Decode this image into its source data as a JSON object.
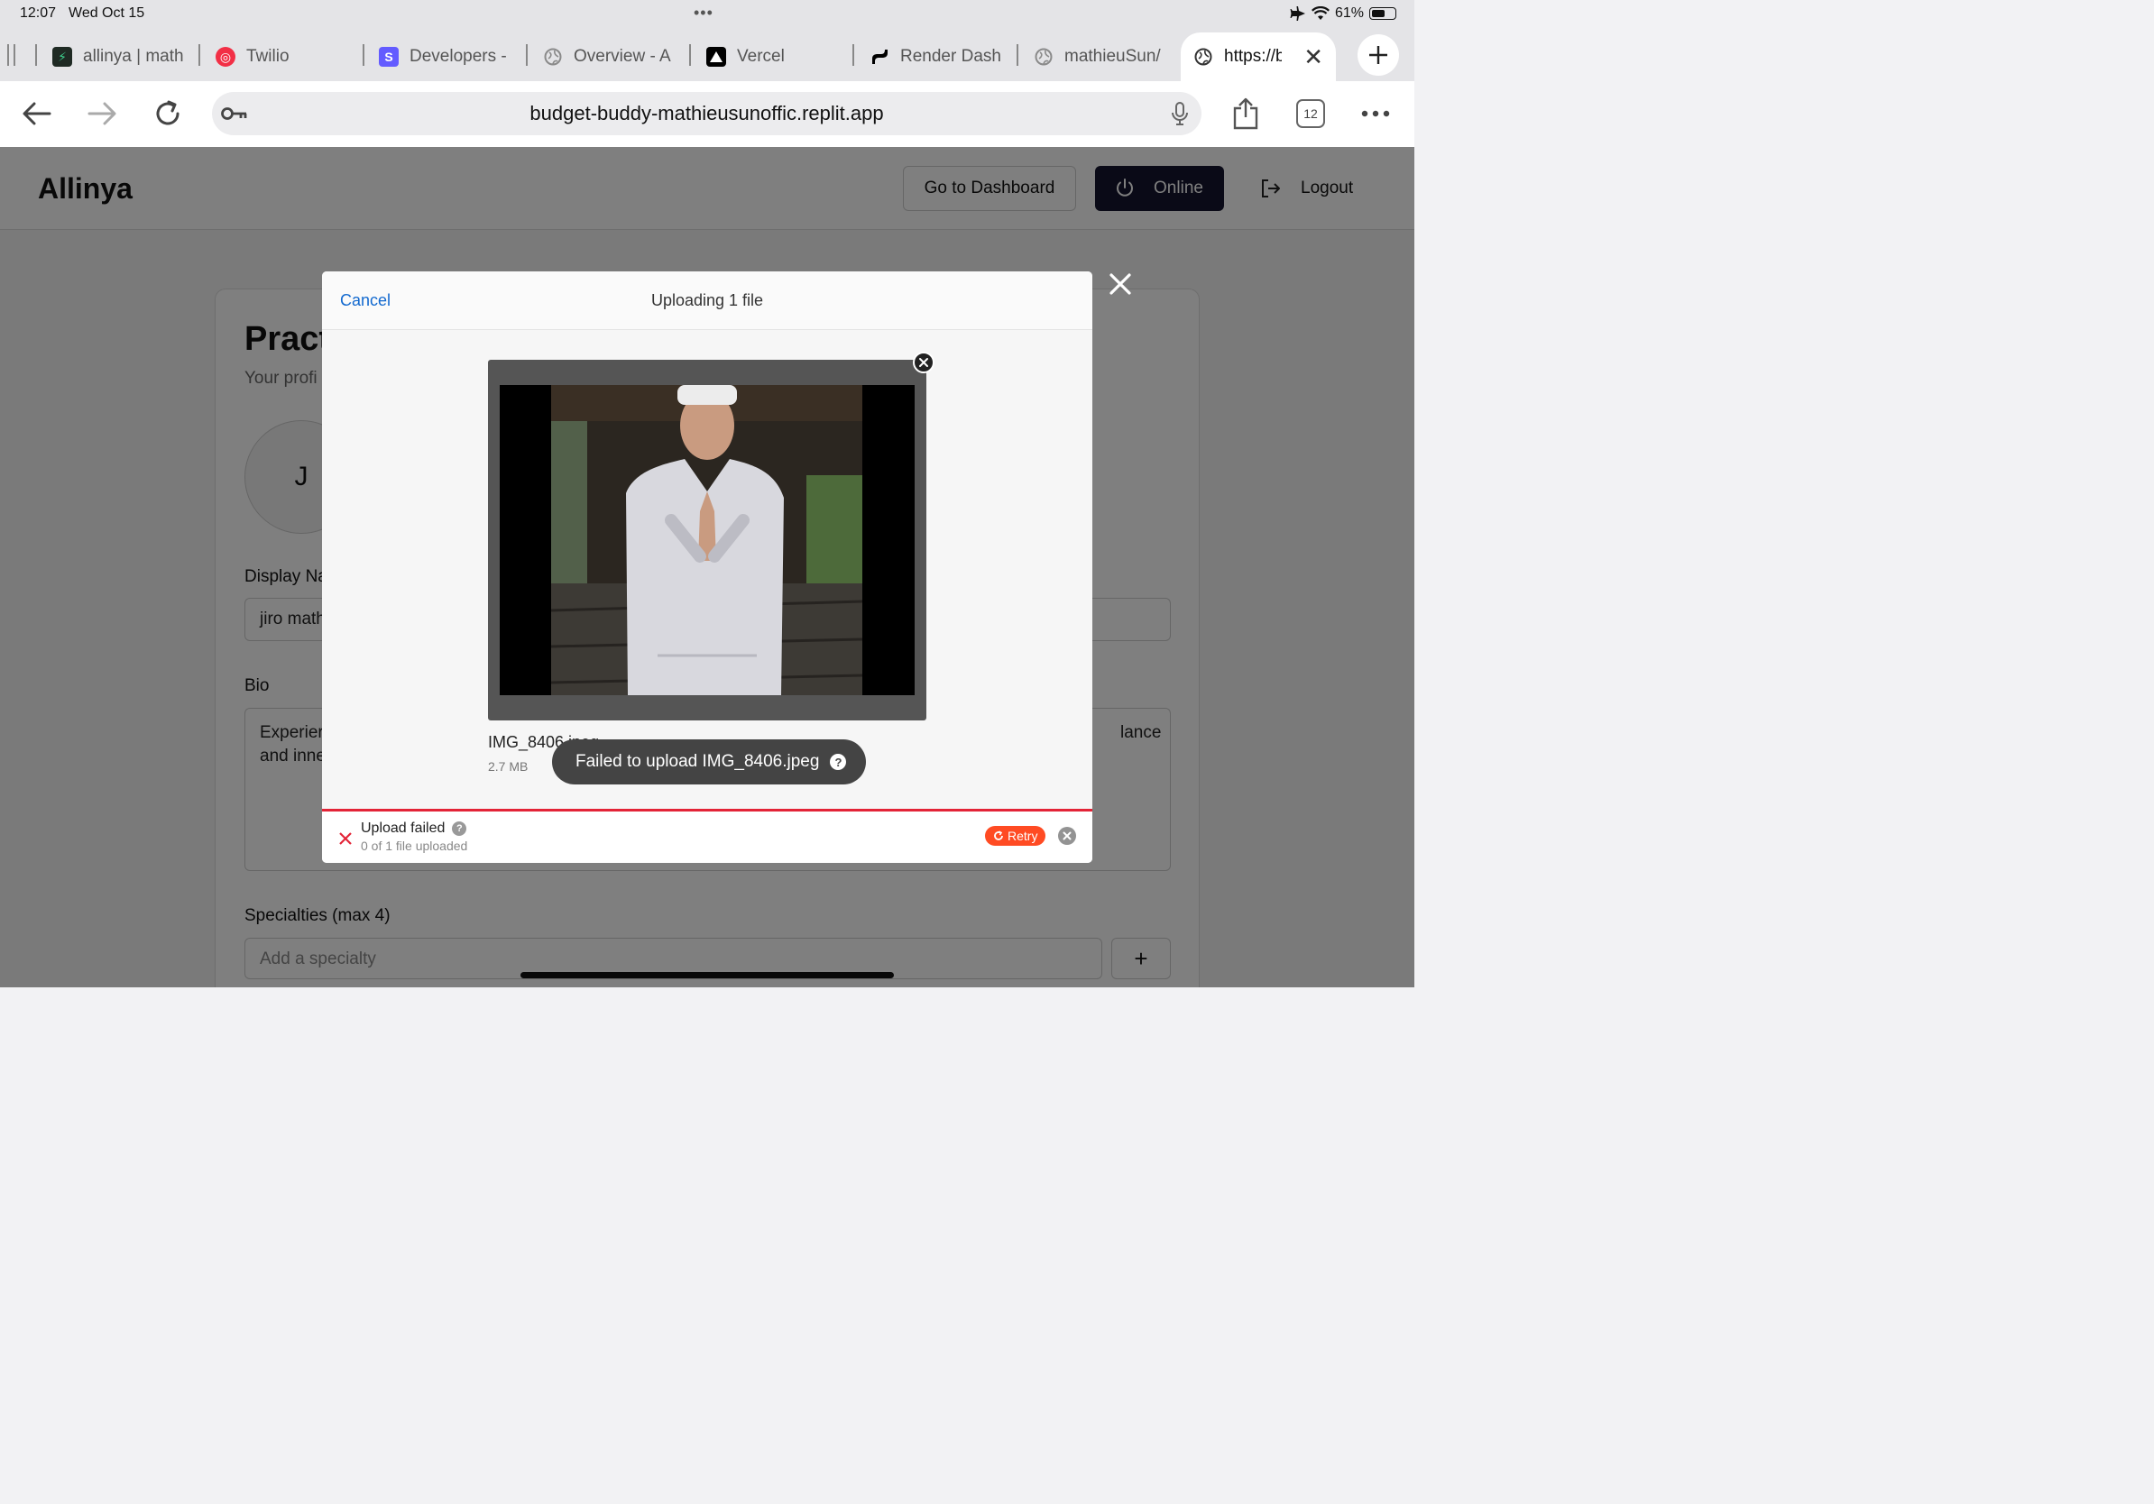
{
  "status_bar": {
    "time": "12:07",
    "date": "Wed Oct 15",
    "battery": "61%",
    "battery_level": 0.61
  },
  "browser": {
    "tabs": [
      {
        "title": "allinya | math",
        "favicon": "bolt-icon",
        "color": "#1f2a24"
      },
      {
        "title": "Twilio",
        "favicon": "twilio-icon",
        "color": "#f22f46"
      },
      {
        "title": "Developers -",
        "favicon": "stripe-icon",
        "color": "#635bff"
      },
      {
        "title": "Overview - A",
        "favicon": "globe-icon",
        "color": "#8a8a8a"
      },
      {
        "title": "Vercel",
        "favicon": "vercel-icon",
        "color": "#000000"
      },
      {
        "title": "Render Dash",
        "favicon": "render-icon",
        "color": "#000000"
      },
      {
        "title": "mathieuSun/",
        "favicon": "globe-icon",
        "color": "#8a8a8a"
      },
      {
        "title": "https://bu",
        "favicon": "globe-icon",
        "color": "#333333",
        "active": true
      }
    ],
    "url": "budget-buddy-mathieusunoffic.replit.app",
    "tab_count": "12"
  },
  "app": {
    "brand": "Allinya",
    "header": {
      "dashboard": "Go to Dashboard",
      "online": "Online",
      "logout": "Logout"
    }
  },
  "profile": {
    "title": "Pract",
    "subtitle": "Your profi",
    "avatar_initial": "J",
    "display_name_label": "Display Na",
    "display_name_value": "jiro math",
    "bio_label": "Bio",
    "bio_line1": "Experier",
    "bio_line2": "and inne",
    "bio_tail": "lance",
    "specialties_label": "Specialties (max 4)",
    "specialty_placeholder": "Add a specialty",
    "add_label": "+"
  },
  "upload_modal": {
    "cancel": "Cancel",
    "title": "Uploading 1 file",
    "file_name": "IMG_8406.jpeg",
    "file_size": "2.7 MB",
    "toast": "Failed to upload IMG_8406.jpeg",
    "status_title": "Upload failed",
    "status_sub": "0 of 1 file uploaded",
    "retry": "Retry",
    "progress": 0
  },
  "colors": {
    "accent": "#1269cf",
    "error": "#e32437",
    "retry": "#ff4b23",
    "online_button": "#15152e"
  }
}
